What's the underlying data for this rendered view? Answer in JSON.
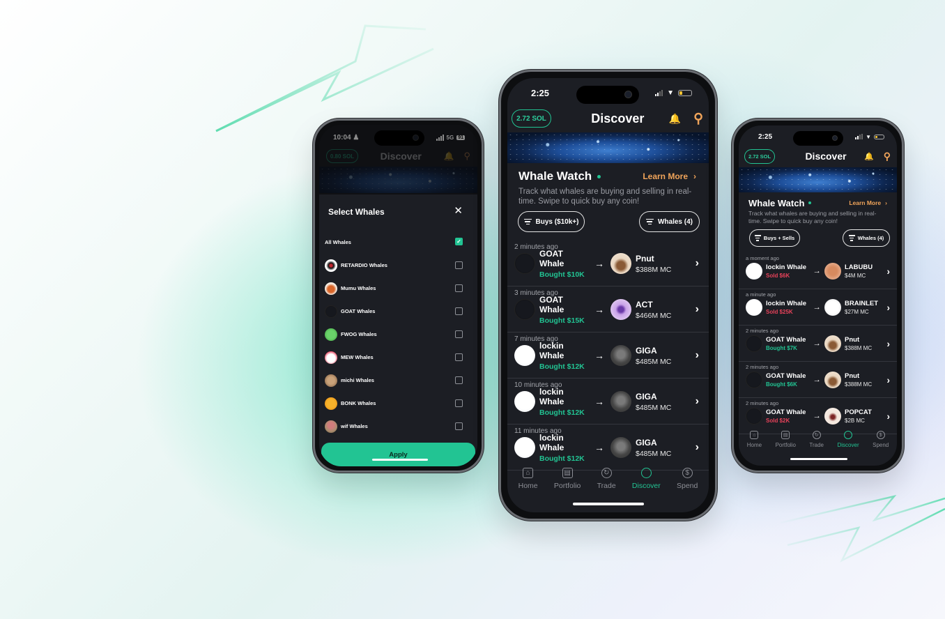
{
  "colors": {
    "accent_green": "#22c493",
    "sell_red": "#e8425a",
    "learn_orange": "#f0a45a",
    "screen_bg": "#1c1e24"
  },
  "left_phone": {
    "status": {
      "time": "10:04",
      "network": "5G",
      "battery": "91"
    },
    "header": {
      "sol_balance": "0.80 SOL",
      "title": "Discover"
    },
    "modal": {
      "title": "Select Whales",
      "close_icon": "close-icon",
      "items": [
        {
          "label": "All Whales",
          "checked": true
        },
        {
          "label": "RETARDIO Whales",
          "checked": false
        },
        {
          "label": "Mumu Whales",
          "checked": false
        },
        {
          "label": "GOAT Whales",
          "checked": false
        },
        {
          "label": "FWOG Whales",
          "checked": false
        },
        {
          "label": "MEW Whales",
          "checked": false
        },
        {
          "label": "michi Whales",
          "checked": false
        },
        {
          "label": "BONK Whales",
          "checked": false
        },
        {
          "label": "wif Whales",
          "checked": false
        }
      ],
      "apply_label": "Apply"
    }
  },
  "center_phone": {
    "status": {
      "time": "2:25"
    },
    "header": {
      "sol_balance": "2.72 SOL",
      "title": "Discover"
    },
    "section": {
      "title": "Whale Watch",
      "learn_more": "Learn More",
      "description": "Track what whales are buying and selling in real-time. Swipe to quick buy any coin!",
      "filter_left": "Buys ($10k+)",
      "filter_right": "Whales (4)"
    },
    "feed": [
      {
        "ago": "2 minutes ago",
        "whale": "GOAT Whale",
        "action": "Bought $10K",
        "type": "buy",
        "coin": "Pnut",
        "mc": "$388M MC"
      },
      {
        "ago": "3 minutes ago",
        "whale": "GOAT Whale",
        "action": "Bought $15K",
        "type": "buy",
        "coin": "ACT",
        "mc": "$466M MC"
      },
      {
        "ago": "7 minutes ago",
        "whale": "lockin Whale",
        "action": "Bought $12K",
        "type": "buy",
        "coin": "GIGA",
        "mc": "$485M MC"
      },
      {
        "ago": "10 minutes ago",
        "whale": "lockin Whale",
        "action": "Bought $12K",
        "type": "buy",
        "coin": "GIGA",
        "mc": "$485M MC"
      },
      {
        "ago": "11 minutes ago",
        "whale": "lockin Whale",
        "action": "Bought $12K",
        "type": "buy",
        "coin": "GIGA",
        "mc": "$485M MC"
      }
    ],
    "tabs": [
      {
        "label": "Home",
        "icon": "home-icon",
        "active": false
      },
      {
        "label": "Portfolio",
        "icon": "portfolio-icon",
        "active": false
      },
      {
        "label": "Trade",
        "icon": "trade-icon",
        "active": false
      },
      {
        "label": "Discover",
        "icon": "discover-icon",
        "active": true
      },
      {
        "label": "Spend",
        "icon": "spend-icon",
        "active": false
      }
    ]
  },
  "right_phone": {
    "status": {
      "time": "2:25"
    },
    "header": {
      "sol_balance": "2.72 SOL",
      "title": "Discover"
    },
    "section": {
      "title": "Whale Watch",
      "learn_more": "Learn More",
      "description": "Track what whales are buying and selling in real-time. Swipe to quick buy any coin!",
      "filter_left": "Buys + Sells",
      "filter_right": "Whales (4)"
    },
    "feed": [
      {
        "ago": "a moment ago",
        "whale": "lockin Whale",
        "action": "Sold $6K",
        "type": "sell",
        "coin": "LABUBU",
        "mc": "$4M MC"
      },
      {
        "ago": "a minute ago",
        "whale": "lockin Whale",
        "action": "Sold $25K",
        "type": "sell",
        "coin": "BRAINLET",
        "mc": "$27M MC"
      },
      {
        "ago": "2 minutes ago",
        "whale": "GOAT Whale",
        "action": "Bought $7K",
        "type": "buy",
        "coin": "Pnut",
        "mc": "$388M MC"
      },
      {
        "ago": "2 minutes ago",
        "whale": "GOAT Whale",
        "action": "Bought $6K",
        "type": "buy",
        "coin": "Pnut",
        "mc": "$388M MC"
      },
      {
        "ago": "2 minutes ago",
        "whale": "GOAT Whale",
        "action": "Sold $2K",
        "type": "sell",
        "coin": "POPCAT",
        "mc": "$2B MC"
      }
    ],
    "tabs": [
      {
        "label": "Home",
        "icon": "home-icon",
        "active": false
      },
      {
        "label": "Portfolio",
        "icon": "portfolio-icon",
        "active": false
      },
      {
        "label": "Trade",
        "icon": "trade-icon",
        "active": false
      },
      {
        "label": "Discover",
        "icon": "discover-icon",
        "active": true
      },
      {
        "label": "Spend",
        "icon": "spend-icon",
        "active": false
      }
    ]
  }
}
